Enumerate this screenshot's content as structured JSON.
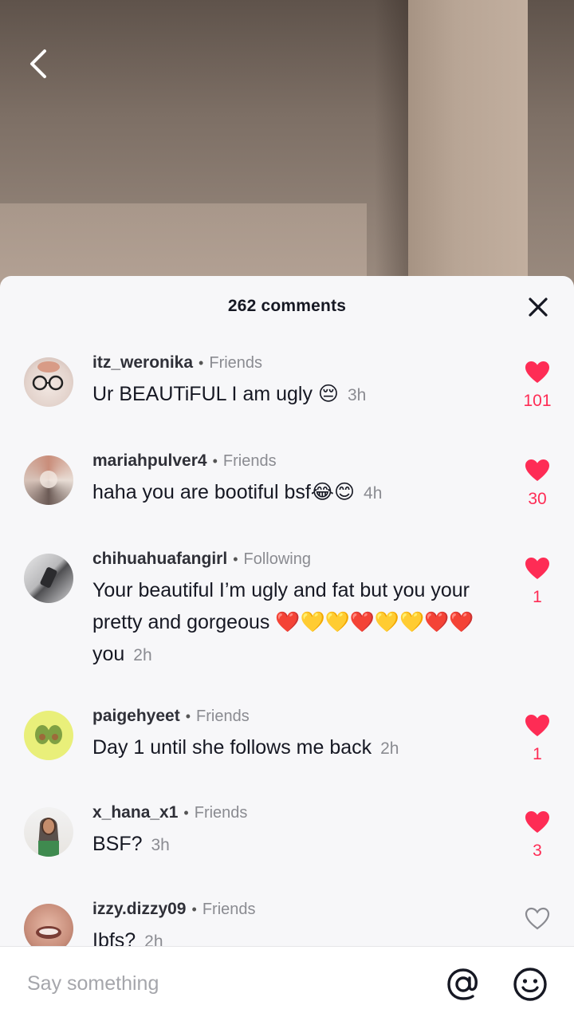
{
  "header": {
    "comment_count": "262 comments"
  },
  "comments": [
    {
      "username": "itz_weronika",
      "relation": "Friends",
      "text": "Ur BEAUTiFUL I am ugly 😔",
      "time": "3h",
      "likes": "101",
      "liked": true
    },
    {
      "username": "mariahpulver4",
      "relation": "Friends",
      "text": "haha you are bootiful bsf😂😊",
      "time": "4h",
      "likes": "30",
      "liked": true
    },
    {
      "username": "chihuahuafangirl",
      "relation": "Following",
      "text": "Your beautiful I’m ugly and fat but you your pretty and gorgeous ❤️💛💛❤️💛💛❤️❤️ you",
      "time": "2h",
      "likes": "1",
      "liked": true
    },
    {
      "username": "paigehyeet",
      "relation": "Friends",
      "text": "Day 1 until she follows me back",
      "time": "2h",
      "likes": "1",
      "liked": true
    },
    {
      "username": "x_hana_x1",
      "relation": "Friends",
      "text": "BSF?",
      "time": "3h",
      "likes": "3",
      "liked": true
    },
    {
      "username": "izzy.dizzy09",
      "relation": "Friends",
      "text": "Ibfs?",
      "time": "2h",
      "likes": "",
      "liked": false
    }
  ],
  "input": {
    "placeholder": "Say something"
  },
  "icons": {
    "back": "chevron-left-icon",
    "close": "close-icon",
    "like": "heart-icon",
    "mention": "at-icon",
    "emoji": "emoji-icon"
  },
  "colors": {
    "like_red": "#fe2c55",
    "text_dark": "#161823",
    "text_muted": "#8a8b91"
  }
}
